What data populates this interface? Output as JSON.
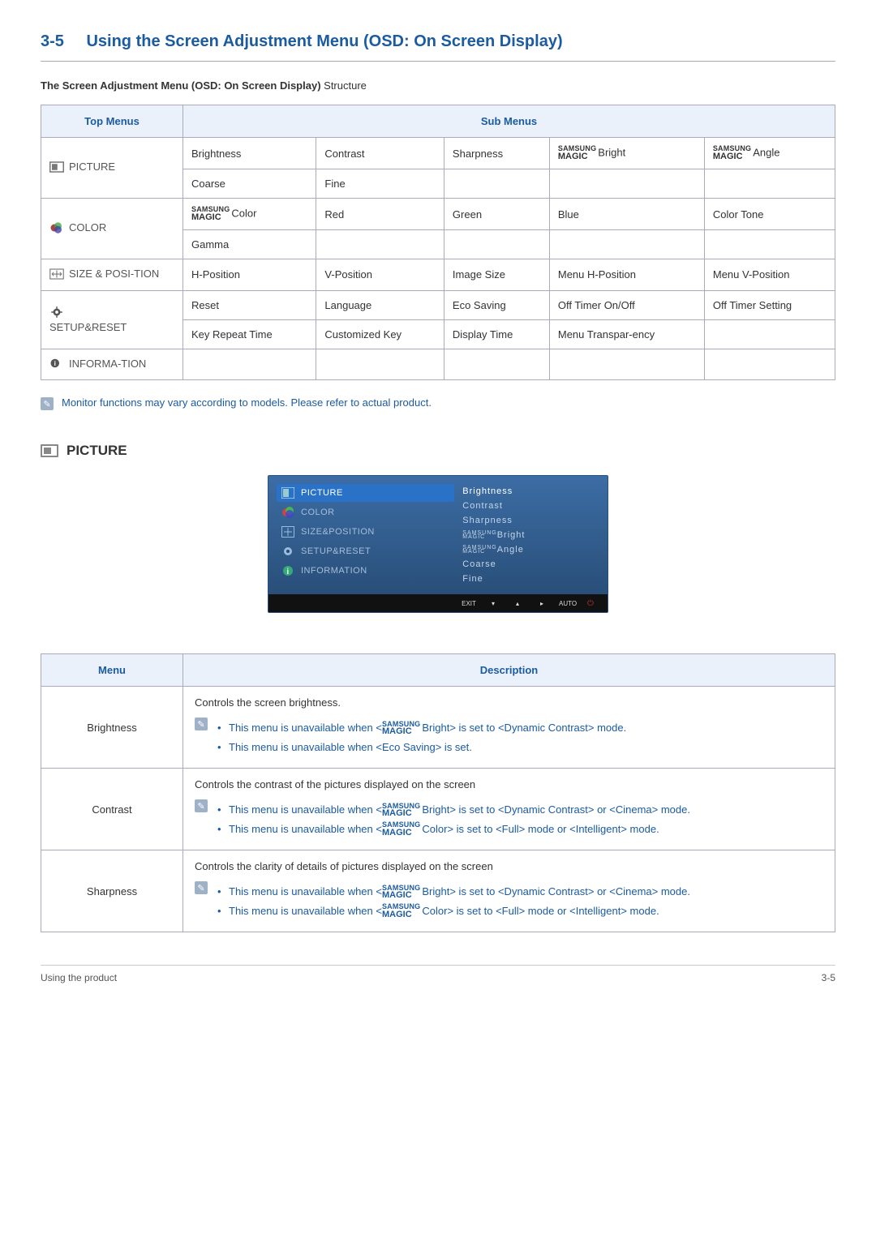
{
  "heading": {
    "number": "3-5",
    "title": "Using the Screen Adjustment Menu (OSD: On Screen Display)"
  },
  "sub_heading": {
    "bold": "The Screen Adjustment Menu (OSD: On Screen Display)",
    "rest": " Structure"
  },
  "structure_table": {
    "top_header": "Top Menus",
    "sub_header": "Sub Menus",
    "rows": {
      "picture": {
        "label": "PICTURE",
        "r1c1": "Brightness",
        "r1c2": "Contrast",
        "r1c3": "Sharpness",
        "r1c4": "Bright",
        "r1c5": "Angle",
        "r2c1": "Coarse",
        "r2c2": "Fine"
      },
      "color": {
        "label": "COLOR",
        "r1c1": "Color",
        "r1c2": "Red",
        "r1c3": "Green",
        "r1c4": "Blue",
        "r1c5": "Color Tone",
        "r2c1": "Gamma"
      },
      "sizepos": {
        "label": "SIZE & POSI-TION",
        "r1c1": "H-Position",
        "r1c2": "V-Position",
        "r1c3": "Image Size",
        "r1c4": "Menu H-Position",
        "r1c5": "Menu V-Position"
      },
      "setup": {
        "label": "SETUP&RESET",
        "r1c1": "Reset",
        "r1c2": "Language",
        "r1c3": "Eco Saving",
        "r1c4": "Off Timer On/Off",
        "r1c5": "Off Timer Setting",
        "r2c1": "Key Repeat Time",
        "r2c2": "Customized Key",
        "r2c3": "Display Time",
        "r2c4": "Menu Transpar-ency"
      },
      "info": {
        "label": "INFORMA-TION"
      }
    }
  },
  "note_text": "Monitor functions may vary according to models. Please refer to actual product.",
  "picture_section_title": "PICTURE",
  "osd": {
    "left": {
      "picture": "PICTURE",
      "color": "COLOR",
      "size": "SIZE&POSITION",
      "setup": "SETUP&RESET",
      "info": "INFORMATION"
    },
    "right": {
      "brightness": "Brightness",
      "contrast": "Contrast",
      "sharpness": "Sharpness",
      "magic_bright_prefix": "SAMSUNG MAGIC",
      "magic_bright": "Bright",
      "magic_angle": "Angle",
      "coarse": "Coarse",
      "fine": "Fine"
    },
    "bottom": {
      "exit": "EXIT",
      "auto": "AUTO"
    }
  },
  "desc_table": {
    "menu_header": "Menu",
    "desc_header": "Description",
    "brightness": {
      "name": "Brightness",
      "intro": "Controls the screen brightness.",
      "li1a": "This menu is unavailable when <",
      "li1b": "Bright> is set to <Dynamic Contrast> mode.",
      "li2": "This menu is unavailable when <Eco Saving> is set."
    },
    "contrast": {
      "name": "Contrast",
      "intro": "Controls the contrast of the pictures displayed on the screen",
      "li1a": "This menu is unavailable when <",
      "li1b": "Bright> is set to <Dynamic Contrast> or <Cinema> mode.",
      "li2a": "This menu is unavailable when <",
      "li2b": "Color> is set to <Full> mode or <Intelligent> mode."
    },
    "sharpness": {
      "name": "Sharpness",
      "intro": "Controls the clarity of details of pictures displayed on the screen",
      "li1a": "This menu is unavailable when <",
      "li1b": "Bright> is set to <Dynamic Contrast> or <Cinema> mode.",
      "li2a": "This menu is unavailable when <",
      "li2b": "Color> is set to <Full> mode or <Intelligent> mode."
    }
  },
  "samsung_magic": {
    "top": "SAMSUNG",
    "bot": "MAGIC"
  },
  "footer": {
    "left": "Using the product",
    "right": "3-5"
  }
}
